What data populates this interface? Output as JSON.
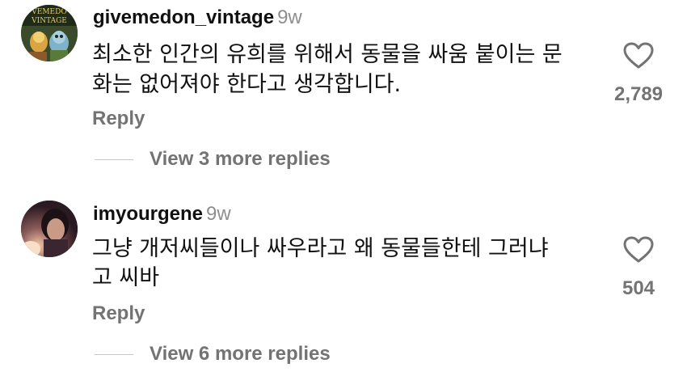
{
  "comments": [
    {
      "username": "givemedon_vintage",
      "time": "9w",
      "text_lines": [
        "최소한 인간의 유희를 위해서 동물을 싸움 붙이는 문",
        "화는 없어져야 한다고 생각합니다."
      ],
      "likes": "2,789",
      "reply_label": "Reply",
      "view_more_label": "View 3 more replies",
      "avatar_text_top": "VEMEDO",
      "avatar_text_bottom": "VINTAGE"
    },
    {
      "username": "imyourgene",
      "time": "9w",
      "text_lines": [
        "그냥 개저씨들이나 싸우라고 왜 동물들한테 그러냐",
        "고 씨바"
      ],
      "likes": "504",
      "reply_label": "Reply",
      "view_more_label": "View 6 more replies"
    }
  ],
  "icons": {
    "like": "heart-outline-icon"
  },
  "colors": {
    "text": "#111111",
    "secondary": "#737373",
    "timestamp": "#8e8e8e",
    "divider": "#c7c7c7"
  }
}
